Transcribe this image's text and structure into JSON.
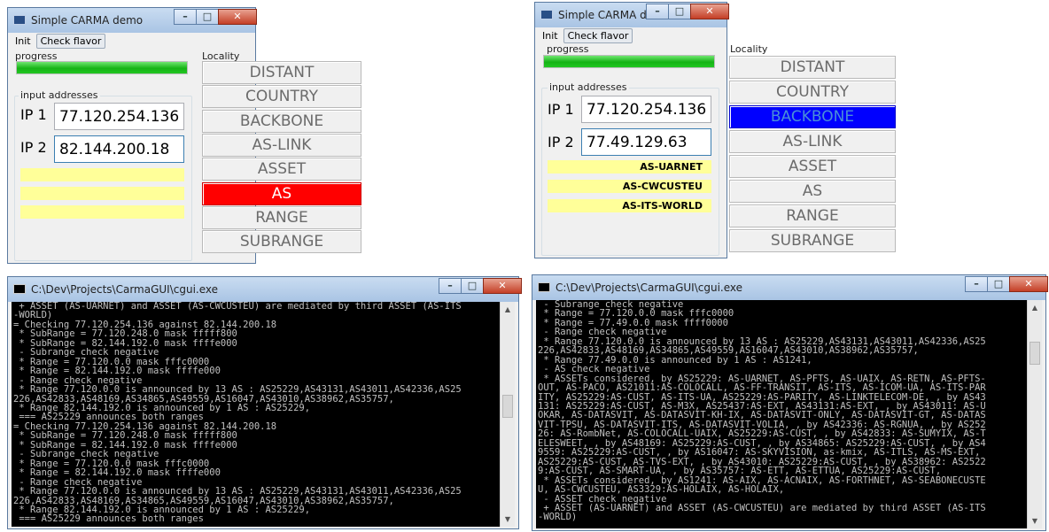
{
  "gui": {
    "title": "Simple CARMA demo",
    "menu": {
      "init": "Init",
      "check_flavor": "Check flavor"
    },
    "progress_label": "progress",
    "locality_label": "Locality",
    "input_group_label": "input addresses",
    "ip1_label": "IP 1",
    "ip2_label": "IP 2",
    "progress_fraction": 1.0,
    "locality_buttons": [
      "DISTANT",
      "COUNTRY",
      "BACKBONE",
      "AS-LINK",
      "ASSET",
      "AS",
      "RANGE",
      "SUBRANGE"
    ],
    "colors": {
      "highlight_red": "#ff0000",
      "highlight_blue": "#0000ff",
      "result_yellow": "#ffff99",
      "progress_green": "#22c722"
    }
  },
  "windows": {
    "gui_left": {
      "ip1": "77.120.254.136",
      "ip2": "82.144.200.18",
      "results": [
        "",
        "",
        ""
      ],
      "highlighted": "AS"
    },
    "gui_right": {
      "ip1": "77.120.254.136",
      "ip2": "77.49.129.63",
      "results": [
        "AS-UARNET",
        "AS-CWCUSTEU",
        "AS-ITS-WORLD"
      ],
      "highlighted": "BACKBONE"
    },
    "console_left": {
      "title": "C:\\Dev\\Projects\\CarmaGUI\\cgui.exe",
      "lines": [
        " + ASSET (AS-UARNET) and ASSET (AS-CWCUSTEU) are mediated by third ASSET (AS-ITS",
        "-WORLD)",
        "= Checking 77.120.254.136 against 82.144.200.18",
        " * SubRange = 77.120.248.0 mask fffff800",
        " * SubRange = 82.144.192.0 mask ffffe000",
        " - Subrange check negative",
        " * Range = 77.120.0.0 mask fffc0000",
        " * Range = 82.144.192.0 mask ffffe000",
        " - Range check negative",
        " * Range 77.120.0.0 is announced by 13 AS : AS25229,AS43131,AS43011,AS42336,AS25",
        "226,AS42833,AS48169,AS34865,AS49559,AS16047,AS43010,AS38962,AS35757,",
        " * Range 82.144.192.0 is announced by 1 AS : AS25229,",
        " === AS25229 announces both ranges",
        "= Checking 77.120.254.136 against 82.144.200.18",
        " * SubRange = 77.120.248.0 mask fffff800",
        " * SubRange = 82.144.192.0 mask ffffe000",
        " - Subrange check negative",
        " * Range = 77.120.0.0 mask fffc0000",
        " * Range = 82.144.192.0 mask ffffe000",
        " - Range check negative",
        " * Range 77.120.0.0 is announced by 13 AS : AS25229,AS43131,AS43011,AS42336,AS25",
        "226,AS42833,AS48169,AS34865,AS49559,AS16047,AS43010,AS38962,AS35757,",
        " * Range 82.144.192.0 is announced by 1 AS : AS25229,",
        " === AS25229 announces both ranges"
      ]
    },
    "console_right": {
      "title": "C:\\Dev\\Projects\\CarmaGUI\\cgui.exe",
      "lines": [
        " - Subrange check negative",
        " * Range = 77.120.0.0 mask fffc0000",
        " * Range = 77.49.0.0 mask ffff0000",
        " - Range check negative",
        " * Range 77.120.0.0 is announced by 13 AS : AS25229,AS43131,AS43011,AS42336,AS25",
        "226,AS42833,AS48169,AS34865,AS49559,AS16047,AS43010,AS38962,AS35757,",
        " * Range 77.49.0.0 is announced by 1 AS : AS1241,",
        " - AS check negative",
        " * ASSETs considered, by AS25229: AS-UARNET, AS-PFTS, AS-UAIX, AS-RETN, AS-PFTS-",
        "OUT, AS-PACO, AS21011:AS-COLOCALL, AS-FF-TRANSIT, AS-ITS, AS-ICOM-UA, AS-ITS-PAR",
        "ITY, AS25229:AS-CUST, AS-ITS-UA, AS25229:AS-PARITY, AS-LINKTELECOM-DE, , by AS43",
        "131: AS25229:AS-CUST, AS-M3X, AS25437:AS-EXT, AS43131:AS-EXT, , by AS43011: AS-U",
        "OKAR, AS-DATASVIT, AS-DATASVIT-KH-IX, AS-DATASVIT-ONLY, AS-DATASVIT-GT, AS-DATAS",
        "VIT-TPSU, AS-DATASVIT-ITS, AS-DATASVIT-VOLIA, , by AS42336: AS-RGNUA, , by AS252",
        "26: AS-RombNet, AS-COLOCALL-UAIX, AS25229:AS-CUST, , by AS42833: AS-SUMYIX, AS-T",
        "ELESWEET, , by AS48169: AS25229:AS-CUST, , by AS34865: AS25229:AS-CUST, , by AS4",
        "9559: AS25229:AS-CUST, , by AS16047: AS-SKYVISION, as-kmix, AS-ITLS, AS-MS-EXT,",
        "AS25229:AS-CUST, AS-TVS-EXT, , by AS43010: AS25229:AS-CUST, , by AS38962: AS2522",
        "9:AS-CUST, AS-SMART-UA, , by AS35757: AS-ETT, AS-ETTUA, AS25229:AS-CUST,",
        " * ASSETs considered, by AS1241: AS-AIX, AS-ACNAIX, AS-FORTHNET, AS-SEABONECUSTE",
        "U, AS-CWCUSTEU, AS3329:AS-HOLAIX, AS-HOLAIX,",
        " - ASSET check negative",
        " + ASSET (AS-UARNET) and ASSET (AS-CWCUSTEU) are mediated by third ASSET (AS-ITS",
        "-WORLD)"
      ]
    }
  }
}
